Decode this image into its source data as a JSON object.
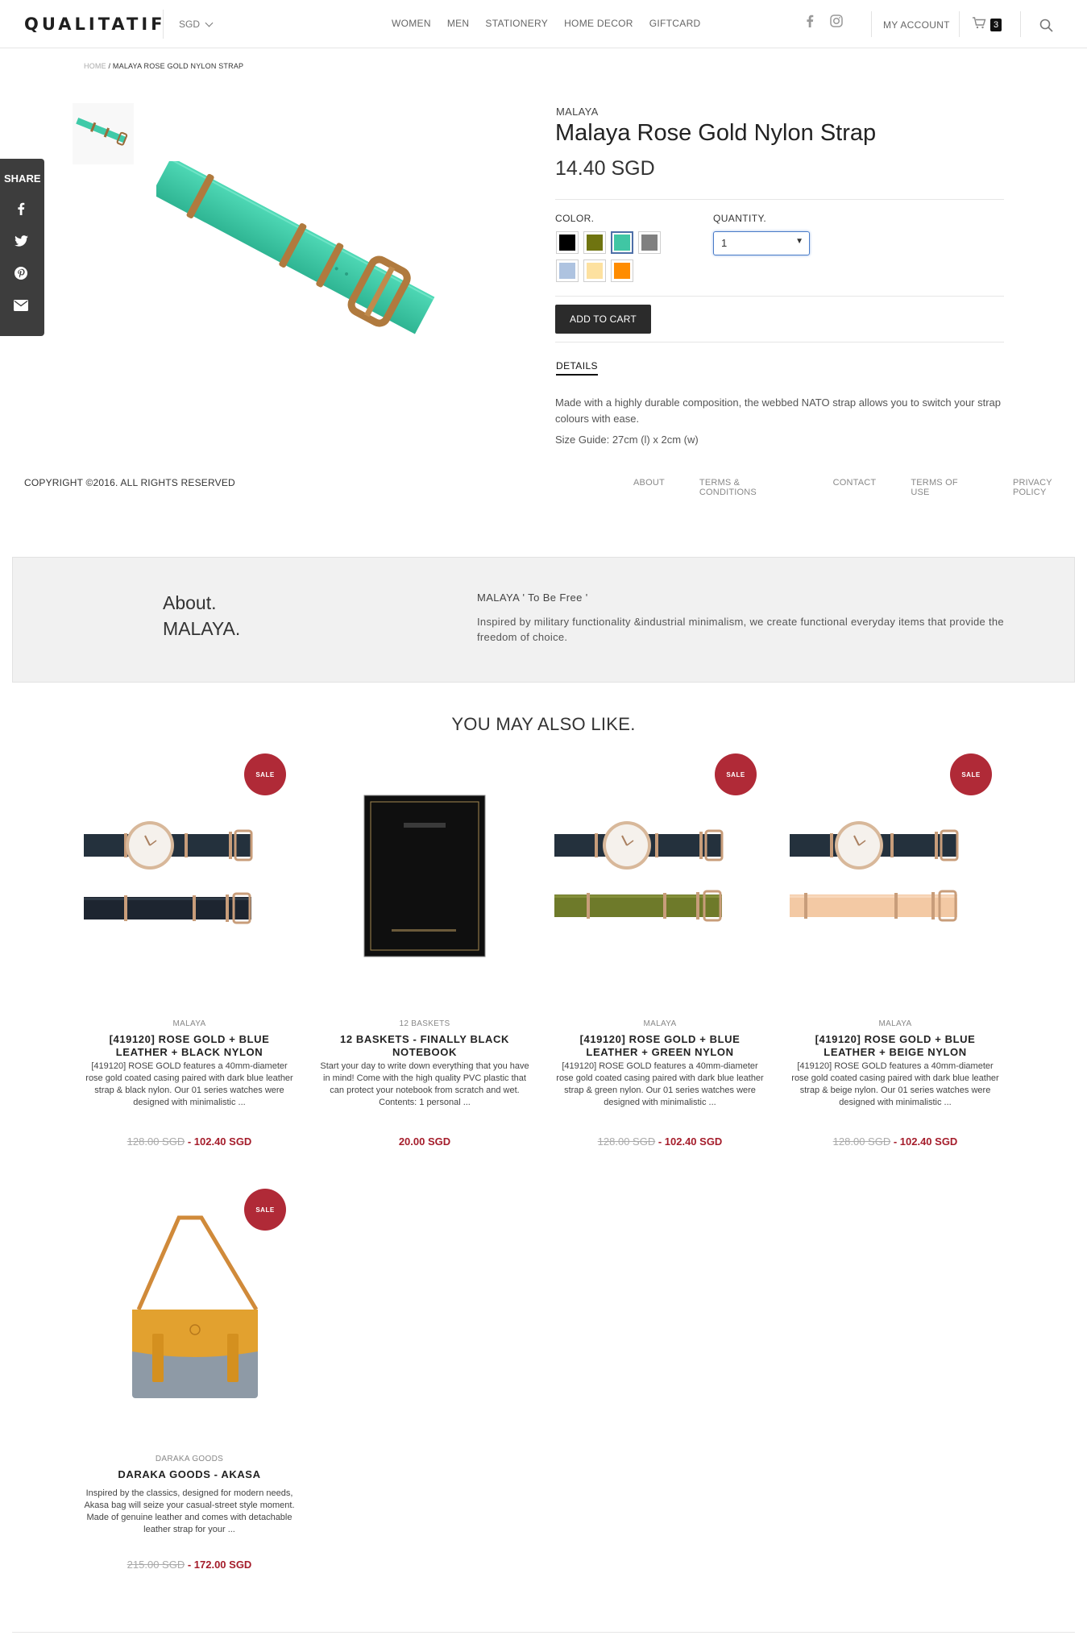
{
  "header": {
    "logo": "QUALITATIF",
    "currency": "SGD",
    "nav": [
      "WOMEN",
      "MEN",
      "STATIONERY",
      "HOME DECOR",
      "GIFTCARD"
    ],
    "account": "MY ACCOUNT",
    "cart_count": "3"
  },
  "breadcrumb": {
    "home": "HOME",
    "sep": " / ",
    "current": "MALAYA ROSE GOLD NYLON STRAP"
  },
  "share": {
    "label": "SHARE",
    "icons": [
      "facebook-icon",
      "twitter-icon",
      "pinterest-icon",
      "mail-icon"
    ]
  },
  "product": {
    "vendor": "MALAYA",
    "title": "Malaya Rose Gold Nylon Strap",
    "price": "14.40 SGD",
    "color_label": "COLOR.",
    "quantity_label": "QUANTITY.",
    "quantity_value": "1",
    "colors": [
      "#000000",
      "#6f7410",
      "#40c6a4",
      "#808080",
      "#aec3e0",
      "#fde1a0",
      "#ff8c00"
    ],
    "selected_color": "#40c6a4",
    "add_to_cart": "ADD TO CART",
    "details_tab": "DETAILS",
    "description": "Made with a highly durable composition, the webbed NATO strap allows you to switch your strap colours with ease.",
    "size_guide": "Size Guide: 27cm (l) x 2cm (w)"
  },
  "footer": {
    "copyright": "COPYRIGHT ©2016. ALL RIGHTS RESERVED",
    "links": [
      "ABOUT",
      "TERMS & CONDITIONS",
      "CONTACT",
      "TERMS OF USE",
      "PRIVACY POLICY"
    ]
  },
  "about": {
    "title_line1": "About.",
    "title_line2": "MALAYA.",
    "tagline": "MALAYA ' To Be Free '",
    "text": "Inspired by military functionality &industrial minimalism, we create functional everyday items that provide the freedom of choice."
  },
  "related": {
    "title": "YOU MAY ALSO LIKE.",
    "sale_label": "SALE",
    "items": [
      {
        "vendor": "MALAYA",
        "title": "[419120] ROSE GOLD + BLUE LEATHER + BLACK NYLON",
        "desc": "[419120] ROSE GOLD features a 40mm-diameter rose gold coated casing paired with dark blue leather strap & black nylon. Our 01 series watches were designed with minimalistic ...",
        "old_price": "128.00 SGD",
        "price": "- 102.40 SGD",
        "sale": true
      },
      {
        "vendor": "12 BASKETS",
        "title": "12 BASKETS - FINALLY BLACK NOTEBOOK",
        "desc": "Start your day to write down everything that you have in mind! Come with the high quality PVC plastic that can protect your notebook from scratch and wet. Contents: 1 personal ...",
        "old_price": "",
        "price": "20.00 SGD",
        "sale": false
      },
      {
        "vendor": "MALAYA",
        "title": "[419120] ROSE GOLD + BLUE LEATHER + GREEN NYLON",
        "desc": "[419120] ROSE GOLD features a 40mm-diameter rose gold coated casing paired with dark blue leather strap & green nylon. Our 01 series watches were designed with minimalistic ...",
        "old_price": "128.00 SGD",
        "price": "- 102.40 SGD",
        "sale": true
      },
      {
        "vendor": "MALAYA",
        "title": "[419120] ROSE GOLD + BLUE LEATHER + BEIGE NYLON",
        "desc": "[419120] ROSE GOLD features a 40mm-diameter rose gold coated casing paired with dark blue leather strap & beige nylon. Our 01 series watches were designed with minimalistic ...",
        "old_price": "128.00 SGD",
        "price": "- 102.40 SGD",
        "sale": true
      },
      {
        "vendor": "DARAKA GOODS",
        "title": "DARAKA GOODS - AKASA",
        "desc": "Inspired by the classics, designed for modern needs, Akasa bag will seize your casual-street style moment. Made of genuine leather and comes with detachable leather strap for your ...",
        "old_price": "215.00 SGD",
        "price": "- 172.00 SGD",
        "sale": true
      }
    ]
  }
}
